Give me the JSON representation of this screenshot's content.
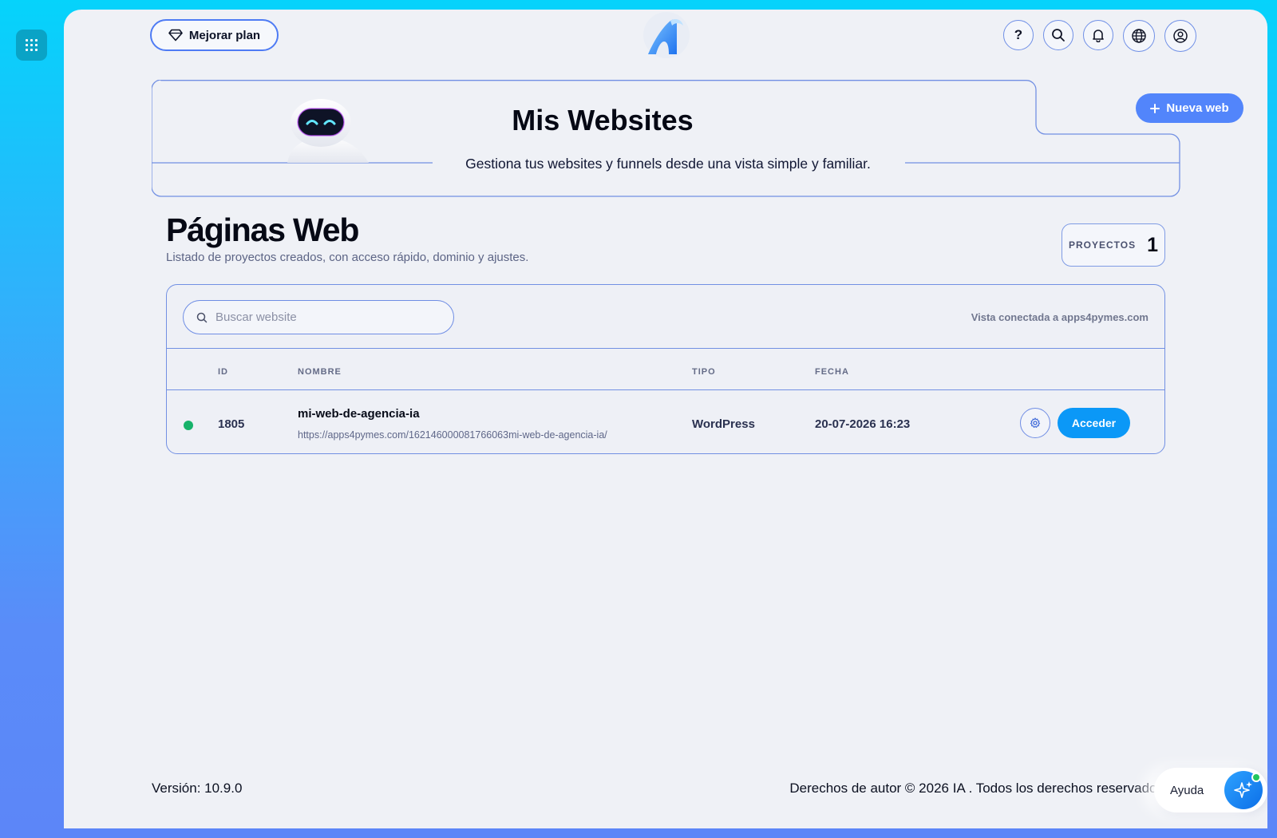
{
  "header": {
    "upgrade_label": "Mejorar plan",
    "icons": [
      "help-icon",
      "search-icon",
      "bell-icon",
      "globe-icon",
      "user-icon"
    ],
    "help_glyph": "?"
  },
  "hero": {
    "title": "Mis Websites",
    "subtitle": "Gestiona tus websites y funnels desde una vista simple y familiar.",
    "new_web_label": "Nueva web"
  },
  "section": {
    "title": "Páginas Web",
    "subtitle": "Listado de proyectos creados, con acceso rápido, dominio y ajustes.",
    "projects_label": "PROYECTOS",
    "projects_count": "1"
  },
  "table": {
    "search_placeholder": "Buscar website",
    "connected_text": "Vista conectada a apps4pymes.com",
    "columns": [
      "ID",
      "NOMBRE",
      "TIPO",
      "FECHA"
    ],
    "rows": [
      {
        "status_color": "#17b26a",
        "id": "1805",
        "name": "mi-web-de-agencia-ia",
        "url": "https://apps4pymes.com/162146000081766063mi-web-de-agencia-ia/",
        "type": "WordPress",
        "date": "20-07-2026 16:23",
        "action_label": "Acceder"
      }
    ]
  },
  "footer": {
    "version": "Versión: 10.9.0",
    "copyright": "Derechos de autor © 2026 IA . Todos los derechos reservados"
  },
  "help": {
    "label": "Ayuda"
  },
  "colors": {
    "accent": "#5285fb",
    "primary_button": "#0b98f7",
    "border": "#7290e3",
    "background": "#eff1f6"
  }
}
